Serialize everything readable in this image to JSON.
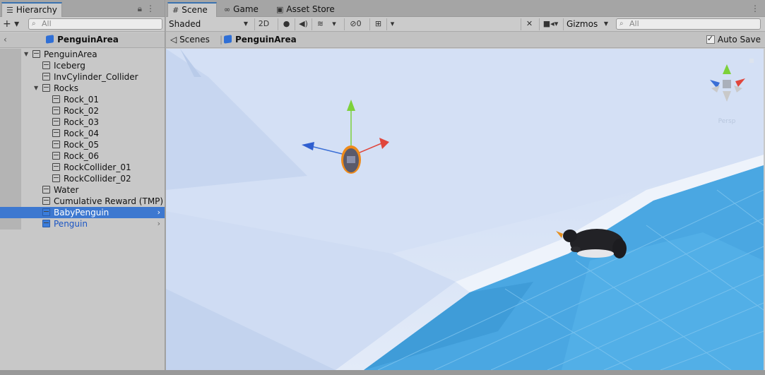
{
  "hierarchy": {
    "tab_label": "Hierarchy",
    "search_placeholder": "All",
    "scene_title": "PenguinArea",
    "items": [
      {
        "label": "PenguinArea",
        "depth": 0,
        "expand": "open",
        "prefab": false,
        "selected": false
      },
      {
        "label": "Iceberg",
        "depth": 1,
        "expand": "none",
        "prefab": false,
        "selected": false
      },
      {
        "label": "InvCylinder_Collider",
        "depth": 1,
        "expand": "none",
        "prefab": false,
        "selected": false
      },
      {
        "label": "Rocks",
        "depth": 1,
        "expand": "open",
        "prefab": false,
        "selected": false
      },
      {
        "label": "Rock_01",
        "depth": 2,
        "expand": "none",
        "prefab": false,
        "selected": false
      },
      {
        "label": "Rock_02",
        "depth": 2,
        "expand": "none",
        "prefab": false,
        "selected": false
      },
      {
        "label": "Rock_03",
        "depth": 2,
        "expand": "none",
        "prefab": false,
        "selected": false
      },
      {
        "label": "Rock_04",
        "depth": 2,
        "expand": "none",
        "prefab": false,
        "selected": false
      },
      {
        "label": "Rock_05",
        "depth": 2,
        "expand": "none",
        "prefab": false,
        "selected": false
      },
      {
        "label": "Rock_06",
        "depth": 2,
        "expand": "none",
        "prefab": false,
        "selected": false
      },
      {
        "label": "RockCollider_01",
        "depth": 2,
        "expand": "none",
        "prefab": false,
        "selected": false
      },
      {
        "label": "RockCollider_02",
        "depth": 2,
        "expand": "none",
        "prefab": false,
        "selected": false
      },
      {
        "label": "Water",
        "depth": 1,
        "expand": "none",
        "prefab": false,
        "selected": false
      },
      {
        "label": "Cumulative Reward (TMP)",
        "depth": 1,
        "expand": "none",
        "prefab": false,
        "selected": false
      },
      {
        "label": "BabyPenguin",
        "depth": 1,
        "expand": "none",
        "prefab": true,
        "selected": true
      },
      {
        "label": "Penguin",
        "depth": 1,
        "expand": "none",
        "prefab": true,
        "selected": false
      }
    ]
  },
  "scene": {
    "tabs": [
      {
        "label": "Scene",
        "icon": "grid-icon",
        "active": true
      },
      {
        "label": "Game",
        "icon": "gamepad-icon",
        "active": false
      },
      {
        "label": "Asset Store",
        "icon": "bag-icon",
        "active": false
      }
    ],
    "shading_mode": "Shaded",
    "two_d_label": "2D",
    "hidden_count": "0",
    "gizmos_label": "Gizmos",
    "search_placeholder": "All",
    "breadcrumb_scenes": "Scenes",
    "breadcrumb_current": "PenguinArea",
    "auto_save_label": "Auto Save",
    "auto_save_checked": true,
    "view_label": "Persp"
  },
  "colors": {
    "selection": "#3d78d0",
    "prefab_text": "#1a55c4",
    "water": "#4aa7e2",
    "ice": "#dbe6f8"
  }
}
